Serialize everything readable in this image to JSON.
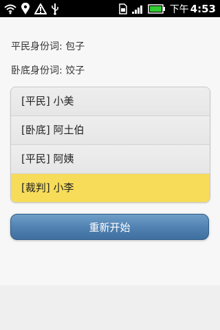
{
  "status_bar": {
    "time_prefix": "下午",
    "time": "4:53",
    "icons": [
      "wifi-icon",
      "location-icon",
      "warning-icon",
      "usb-icon",
      "sim-icon",
      "signal-icon",
      "battery-icon"
    ]
  },
  "info": {
    "civilian_word": "平民身份词: 包子",
    "undercover_word": "卧底身份词: 饺子"
  },
  "players": [
    {
      "label": "[平民] 小美",
      "active": false
    },
    {
      "label": "[卧底] 阿土伯",
      "active": false
    },
    {
      "label": "[平民] 阿姨",
      "active": false
    },
    {
      "label": "[裁判] 小李",
      "active": true
    }
  ],
  "actions": {
    "restart_label": "重新开始"
  },
  "colors": {
    "status_bg": "#000000",
    "page_bg": "#f7f7f7",
    "highlight": "#f7dc5a",
    "button": "#4f80b0"
  }
}
